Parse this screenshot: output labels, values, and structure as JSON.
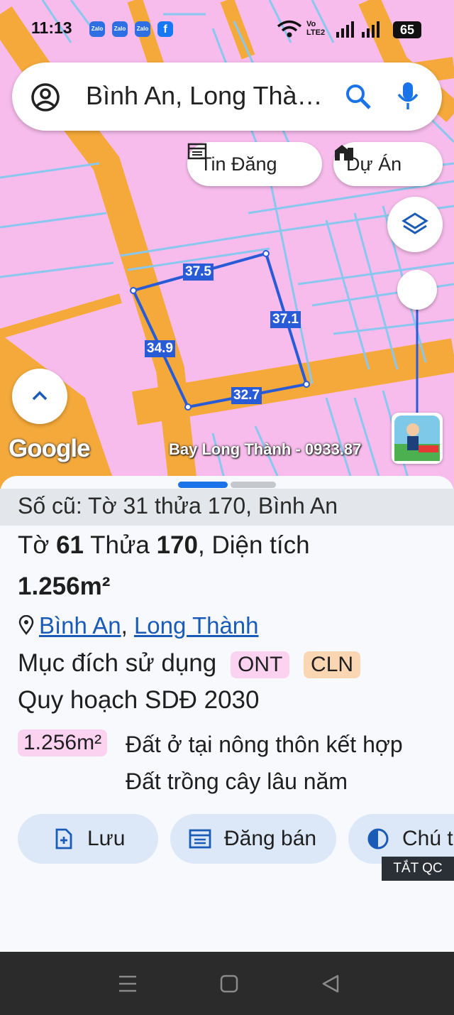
{
  "status_bar": {
    "time": "11:13",
    "apps": [
      "Zalo",
      "Zalo",
      "Zalo",
      "f"
    ],
    "network_label": "Vo LTE2",
    "battery": "65"
  },
  "search": {
    "query": "Bình An, Long Thà…",
    "icons": [
      "account-circle-icon",
      "search-icon",
      "mic-icon"
    ]
  },
  "chips": {
    "listings": "Tin Đăng",
    "projects": "Dự Án"
  },
  "map": {
    "colors": {
      "land": "#f7bcec",
      "road": "#f5a93a",
      "parcel": "#2a5bd7",
      "lines": "#89c7ef"
    },
    "plot_edges": [
      "37.5",
      "37.1",
      "34.9",
      "32.7"
    ],
    "google_logo": "Google",
    "watermark": "Bay Long Thành - 0933.87"
  },
  "sheet": {
    "old_ref": "Số cũ: Tờ 31 thửa 170, Bình An",
    "sheet_label": "Tờ",
    "sheet_no": "61",
    "plot_label": "Thửa",
    "plot_no": "170",
    "area_label": ", Diện tích",
    "area": "1.256m²",
    "ward": "Bình An",
    "district": "Long Thành",
    "sep": ",",
    "purpose_label": "Mục đích sử dụng",
    "badges": [
      {
        "code": "ONT",
        "bg": "#fbd3f1"
      },
      {
        "code": "CLN",
        "bg": "#fbd6b2"
      }
    ],
    "plan_title": "Quy hoạch SDĐ 2030",
    "plan_area": "1.256m²",
    "plan_uses": [
      "Đất ở tại nông thôn kết hợp",
      "Đất trồng cây lâu năm"
    ]
  },
  "actions": {
    "save": "Lưu",
    "post": "Đăng bán",
    "note": "Chú t"
  },
  "ad_toggle": "TẮT QC"
}
